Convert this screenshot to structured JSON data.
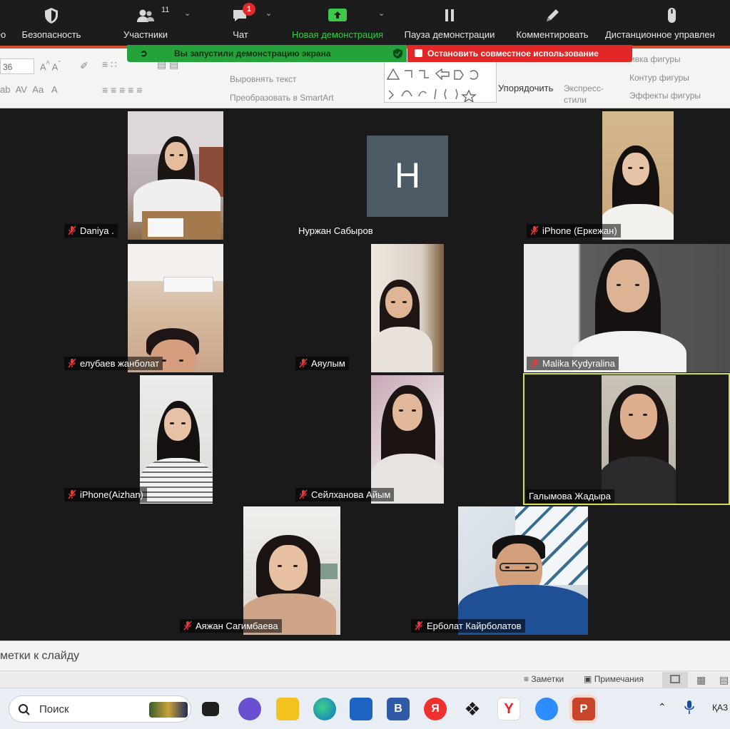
{
  "toolbar": {
    "items": [
      {
        "label": "ео",
        "icon": "video-icon"
      },
      {
        "label": "Безопасность",
        "icon": "shield-icon"
      },
      {
        "label": "Участники",
        "icon": "participants-icon",
        "count": "11"
      },
      {
        "label": "Чат",
        "icon": "chat-icon",
        "badge": "1"
      },
      {
        "label": "Новая демонстрация",
        "icon": "share-screen-icon"
      },
      {
        "label": "Пауза демонстрации",
        "icon": "pause-icon"
      },
      {
        "label": "Комментировать",
        "icon": "pencil-icon"
      },
      {
        "label": "Дистанционное управлен",
        "icon": "mouse-icon"
      }
    ],
    "accent_green": "#23a33a",
    "accent_red": "#e32626"
  },
  "share_banner": {
    "status_text": "Вы запустили демонстрацию экрана",
    "stop_text": "Остановить совместное использование"
  },
  "ribbon": {
    "font_size": "36",
    "align_text": "Выровнять текст",
    "smartart": "Преобразовать в SmartArt",
    "arrange": "Упорядочить",
    "quick_styles": "Экспресс-стили",
    "shape_fill": "Заливка фигуры",
    "shape_outline": "Контур фигуры",
    "shape_effects": "Эффекты фигуры"
  },
  "gallery": {
    "participants": [
      {
        "name": "Daniya ."
      },
      {
        "name": "Нуржан Сабыров",
        "initial": "H"
      },
      {
        "name": "iPhone (Еркежан)"
      },
      {
        "name": "елубаев жанболат"
      },
      {
        "name": "Аяулым"
      },
      {
        "name": "Malika Kydyralina"
      },
      {
        "name": "iPhone(Aizhan)"
      },
      {
        "name": "Сейлханова Айым"
      },
      {
        "name": "Галымова Жадыра"
      },
      {
        "name": "Аяжан Сагимбаева"
      },
      {
        "name": "Ерболат Кайрболатов"
      }
    ],
    "active_speaker": "Галымова Жадыра",
    "active_color": "#d8dc52"
  },
  "ppt": {
    "notes_placeholder": "метки к слайду",
    "notes_button": "Заметки",
    "comments_button": "Примечания"
  },
  "taskbar": {
    "search_placeholder": "Поиск",
    "tray_lang": "ҚАЗ"
  }
}
